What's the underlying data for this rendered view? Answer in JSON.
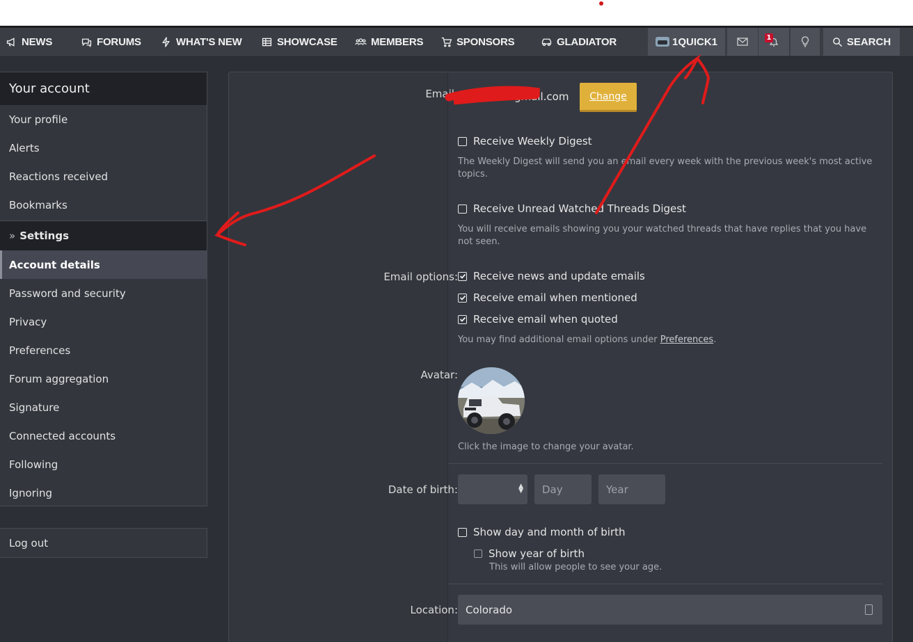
{
  "nav": {
    "news": "NEWS",
    "forums": "FORUMS",
    "whats_new": "WHAT'S NEW",
    "showcase": "SHOWCASE",
    "members": "MEMBERS",
    "sponsors": "SPONSORS",
    "gladiator": "GLADIATOR",
    "user": "1QUICK1",
    "alerts_count": "1",
    "search": "SEARCH"
  },
  "sidebar": {
    "title": "Your account",
    "items": [
      "Your profile",
      "Alerts",
      "Reactions received",
      "Bookmarks"
    ],
    "section": "Settings",
    "section_marker": "»",
    "settings": [
      "Account details",
      "Password and security",
      "Privacy",
      "Preferences",
      "Forum aggregation",
      "Signature",
      "Connected accounts",
      "Following",
      "Ignoring"
    ],
    "logout": "Log out"
  },
  "form": {
    "email_label": "Email:",
    "email_value": "gmail.com",
    "change_button": "Change",
    "weekly_digest": "Receive Weekly Digest",
    "weekly_digest_hint": "The Weekly Digest will send you an email every week with the previous week's most active topics.",
    "unread_digest": "Receive Unread Watched Threads Digest",
    "unread_digest_hint": "You will receive emails showing you your watched threads that have replies that you have not seen.",
    "email_options_label": "Email options:",
    "opt_news": "Receive news and update emails",
    "opt_mentioned": "Receive email when mentioned",
    "opt_quoted": "Receive email when quoted",
    "opt_hint_prefix": "You may find additional email options under ",
    "opt_hint_link": "Preferences",
    "opt_hint_suffix": ".",
    "avatar_label": "Avatar:",
    "avatar_hint": "Click the image to change your avatar.",
    "dob_label": "Date of birth:",
    "day_placeholder": "Day",
    "year_placeholder": "Year",
    "show_dob": "Show day and month of birth",
    "show_year": "Show year of birth",
    "show_year_hint": "This will allow people to see your age.",
    "location_label": "Location:",
    "location_value": "Colorado"
  },
  "colors": {
    "accent_button": "#e0b13a",
    "annotation": "#e01b1b"
  }
}
